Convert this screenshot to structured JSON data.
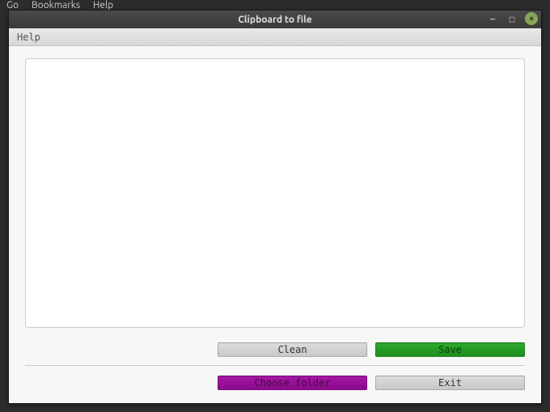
{
  "desktop": {
    "menu": {
      "go": "Go",
      "bookmarks": "Bookmarks",
      "help": "Help"
    }
  },
  "window": {
    "title": "Clipboard to file",
    "controls": {
      "minimize": "−",
      "maximize": "□",
      "close": "×"
    }
  },
  "app": {
    "menu": {
      "help": "Help"
    }
  },
  "textarea": {
    "value": ""
  },
  "buttons": {
    "clean": "Clean",
    "save": "Save",
    "choose_folder": "Choose folder",
    "exit": "Exit"
  }
}
